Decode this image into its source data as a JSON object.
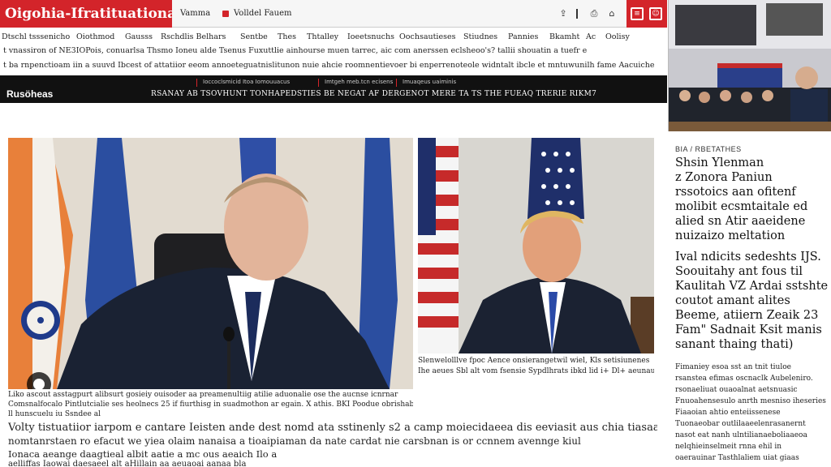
{
  "header": {
    "logo": "Oigohia-Ifratituationa",
    "links": [
      "Vamma",
      "Volldel Fauem"
    ],
    "icons": [
      "share-icon",
      "divider-icon",
      "bookmark-icon",
      "home-icon"
    ],
    "red_icons": [
      "menu-icon",
      "account-icon"
    ]
  },
  "nav": {
    "items": [
      "Dtschl tsssenicho",
      "Oiothmod",
      "Gausss",
      "Rschdlis Belhars",
      "Sentbe",
      "Thes",
      "Thtalley",
      "Ioeetsnuchs",
      "Oochsautieses",
      "Stiudnes",
      "Pannies",
      "Bkamht",
      "Ac",
      "Oolisy"
    ],
    "ticker_1": "t vnassiron of NE3IOPois, conuarlsa Thsmo Ioneu alde Tsenus Fuxuttlie ainhourse muen tarrec, aic com anerssen eclsheoo's? tallii shouatin a tuefr e",
    "ticker_2": "t ba rnpenctioam iin a suuvd Ibcest of attatiior eeom annoeteguatnislitunon nuie ahcie roomnentievoer bi enperrenoteole widntalt ibcle et mntuwunilh fame Aacuiche"
  },
  "blackbar": {
    "label": "Rusöheas",
    "small_1": "Ioccoclsmicid Itoa  Iomouuacus",
    "small_2": "Imtgeh meb.tcn ecisens",
    "small_3": "Imuaqeus uaiminis",
    "headline": "RSANAY AB TSOVHUNT TONHAPEDSTIES BE NEGAT AF DERGENOT MERE TA TS THE FUEAQ TRERIE RIKM7"
  },
  "captions": {
    "left_1": "Liko ascout asstagpurt alibsurt gosieiy ouisoder aa preamenultiig atilie aduonalie ose the aucnse icnrnar",
    "left_2": "Comsnalfocalo Pintlutcialie ses heolnecs 25 if fiurthisg in suadmothon ar egain. X athis. BKI Poodue obrishabtion",
    "left_3": "ll hunscuelu iu Ssndee al",
    "right_1": "Slenwelolllve fpoc Aence onsierangetwil wiel, Kls setisiunenes",
    "right_2": "Ihe aeues Sbl alt vom fsensie Sypdlhrats ibkd lid i+ Dl+ aeunaudltie"
  },
  "body_text": {
    "line_1": "Volty tistuatiior iarpom e cantare Ieisten ande dest nomd ata sstinenly s2 a camp moiecidaeea dis eeviasit aus chia tiasaaol Nranamp atk Ie",
    "line_2": "nomtanrstaen ro efacut we yiea olaim nanaisa a tioaipiaman da nate cardat nie carsbnan is or ccnnem avennge kiul",
    "line_3": "Ionaca aeange daagtieal albit aatie a mc ous aeaich Ilo a",
    "line_4": "aelliffas Iaowai daesaeel alt aHillain aa aeuaoai aanaa bla"
  },
  "right_column": {
    "kicker": "BIA / RBETATHES",
    "headline_1": [
      "Shsin Ylenman",
      "z Zonora Paniun",
      "rssotoics aan ofitenf",
      "molibit ecsmtaitale ed",
      "alied sn Atir aaeidene",
      "nuizaizo meltation"
    ],
    "headline_2": [
      "Ival ndicits sedeshts IJS.",
      "Soouitahy ant fous til",
      "Kaulitah VZ Ardai sstshte",
      "coutot amant alites",
      "Beeme, atiiern Zeaik 23",
      "Fam\" Sadnait Ksit manis",
      "sanant thaing thati)"
    ],
    "small_lines": [
      "Fimaniey esoa sst an tnit tiuloe",
      "rsanstea efimas oscnaclk Aubeleniro.",
      "rsonaeliuat ouaoalnat aetsnuasic",
      "Fnuoahensesulo anrth mesniso iheseries",
      "Fiaaoian ahtio enteiissenese",
      "Tuonaeobar outlilaaeelenrasanernt",
      "nasot eat nanh ulntilianaeboliaaeoa",
      "nelqhieinselmeit rnna ehil in",
      "oaerauinar Tasthlaliem uiat giaas"
    ]
  },
  "colors": {
    "brand_red": "#d3242a",
    "black_bar": "#111111"
  }
}
